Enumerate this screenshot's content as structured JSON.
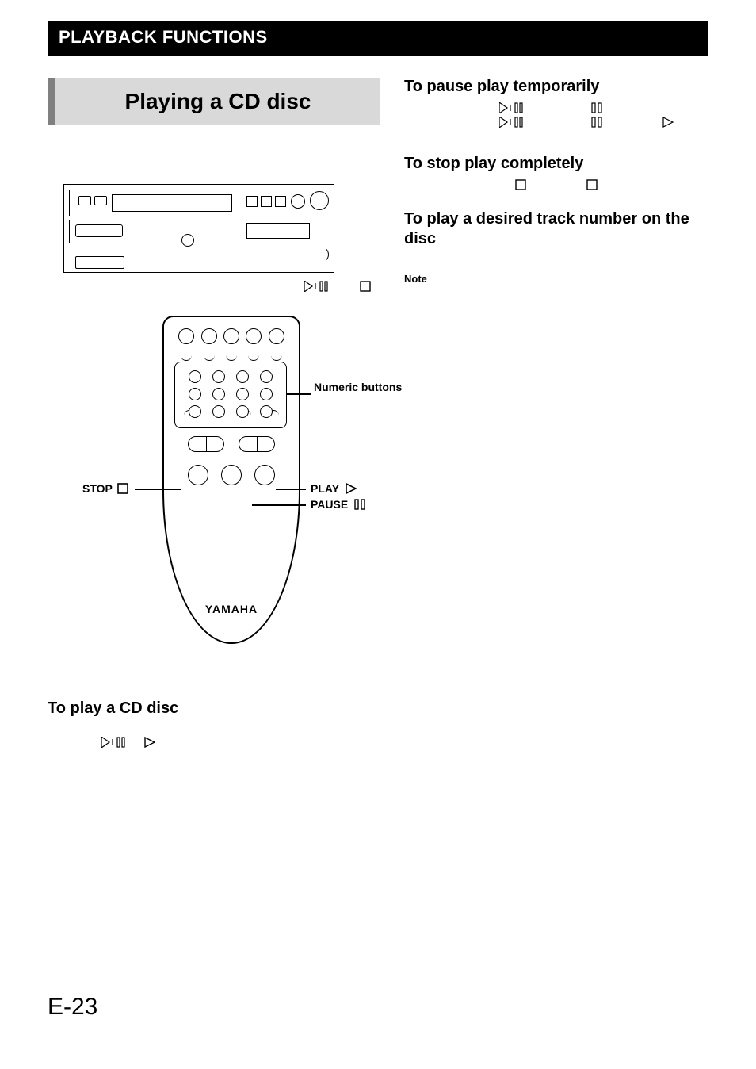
{
  "header": "PLAYBACK FUNCTIONS",
  "title": "Playing a CD disc",
  "unit_labels": {
    "left_btn": "w/d",
    "right_btn": "a"
  },
  "remote": {
    "brand": "YAMAHA",
    "callouts": {
      "numeric": "Numeric buttons",
      "stop": "STOP",
      "play": "PLAY",
      "pause": "PAUSE"
    }
  },
  "left_section": {
    "heading": "To play a CD disc"
  },
  "right_sections": {
    "pause": {
      "heading": "To pause play temporarily"
    },
    "stop": {
      "heading": "To stop play completely"
    },
    "track": {
      "heading": "To play a desired track number on the disc"
    },
    "note_label": "Note"
  },
  "page_number": "E-23"
}
